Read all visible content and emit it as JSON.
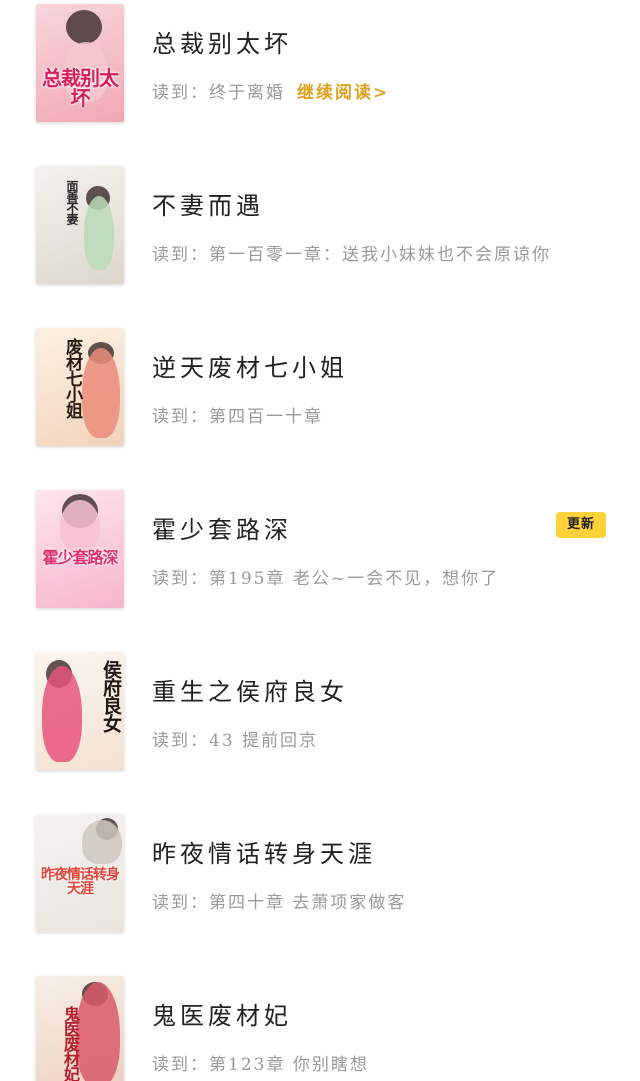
{
  "shelf": {
    "progress_prefix": "读到：",
    "continue_label": "继续阅读>",
    "update_badge": "更新",
    "books": [
      {
        "title": "总裁别太坏",
        "progress": "终于离婚",
        "show_continue": true,
        "has_update": false,
        "cover_text": "总裁别太坏",
        "cover_palette": {
          "bg1": "#f7d6dc",
          "bg2": "#f1a7b6",
          "figure": "#f3c8cf",
          "text": "#d81e5b"
        }
      },
      {
        "title": "不妻而遇",
        "progress": "第一百零一章：送我小妹妹也不会原谅你",
        "show_continue": false,
        "has_update": false,
        "cover_text": "面善不妻",
        "cover_palette": {
          "bg1": "#f4f2ee",
          "bg2": "#dcd6cf",
          "figure": "#b9d9b7",
          "text": "#2b2b2b"
        }
      },
      {
        "title": "逆天废材七小姐",
        "progress": "第四百一十章",
        "show_continue": false,
        "has_update": false,
        "cover_text": "废材七小姐",
        "cover_palette": {
          "bg1": "#fbf1e4",
          "bg2": "#f2d3bb",
          "figure": "#e98c79",
          "text": "#2a1c14"
        }
      },
      {
        "title": "霍少套路深",
        "progress": "第195章 老公~一会不见，想你了",
        "show_continue": false,
        "has_update": true,
        "cover_text": "霍少套路深",
        "cover_palette": {
          "bg1": "#fde5ee",
          "bg2": "#f6b5cc",
          "figure": "#f7c2d3",
          "text": "#e0306f"
        }
      },
      {
        "title": "重生之侯府良女",
        "progress": "43 提前回京",
        "show_continue": false,
        "has_update": false,
        "cover_text": "侯府良女",
        "cover_palette": {
          "bg1": "#fbf6f0",
          "bg2": "#f2e1d2",
          "figure": "#e6557a",
          "text": "#1d1715"
        }
      },
      {
        "title": "昨夜情话转身天涯",
        "progress": "第四十章 去萧项家做客",
        "show_continue": false,
        "has_update": false,
        "cover_text": "昨夜情话转身天涯",
        "cover_palette": {
          "bg1": "#f5f3f1",
          "bg2": "#e9e4df",
          "figure": "#cfc7c0",
          "text": "#e2453c"
        }
      },
      {
        "title": "鬼医废材妃",
        "progress": "第123章 你别瞎想",
        "show_continue": false,
        "has_update": false,
        "cover_text": "鬼医废材妃",
        "cover_palette": {
          "bg1": "#f7efe6",
          "bg2": "#eccfc0",
          "figure": "#d9596a",
          "text": "#b21f2d"
        }
      }
    ]
  }
}
